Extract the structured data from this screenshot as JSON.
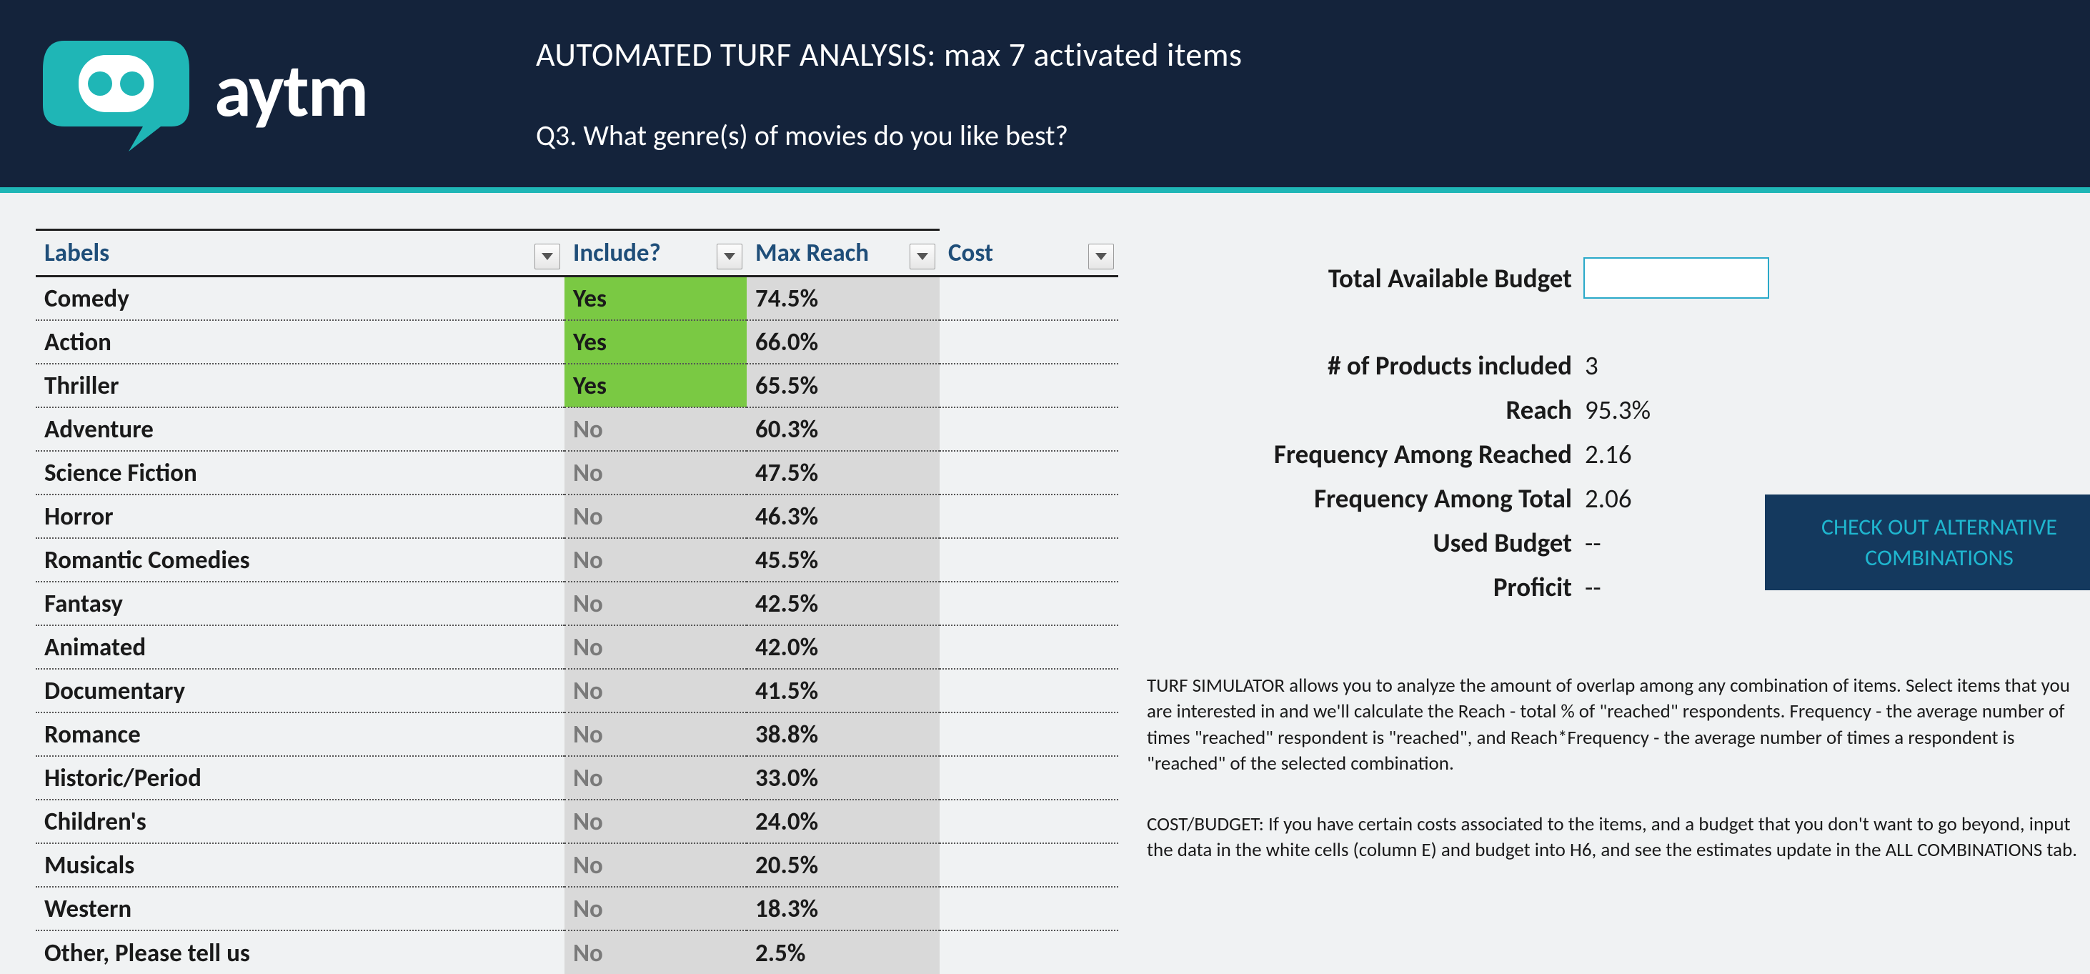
{
  "brand": {
    "name": "aytm"
  },
  "header": {
    "analysis_title": "AUTOMATED TURF ANALYSIS: max 7 activated items",
    "question_title": "Q3. What genre(s) of movies do you like best?"
  },
  "table": {
    "headers": {
      "labels": "Labels",
      "include": "Include?",
      "max_reach": "Max Reach",
      "cost": "Cost"
    },
    "rows": [
      {
        "label": "Comedy",
        "include": "Yes",
        "reach": "74.5%",
        "cost": ""
      },
      {
        "label": "Action",
        "include": "Yes",
        "reach": "66.0%",
        "cost": ""
      },
      {
        "label": "Thriller",
        "include": "Yes",
        "reach": "65.5%",
        "cost": ""
      },
      {
        "label": "Adventure",
        "include": "No",
        "reach": "60.3%",
        "cost": ""
      },
      {
        "label": "Science Fiction",
        "include": "No",
        "reach": "47.5%",
        "cost": ""
      },
      {
        "label": "Horror",
        "include": "No",
        "reach": "46.3%",
        "cost": ""
      },
      {
        "label": "Romantic Comedies",
        "include": "No",
        "reach": "45.5%",
        "cost": ""
      },
      {
        "label": "Fantasy",
        "include": "No",
        "reach": "42.5%",
        "cost": ""
      },
      {
        "label": "Animated",
        "include": "No",
        "reach": "42.0%",
        "cost": ""
      },
      {
        "label": "Documentary",
        "include": "No",
        "reach": "41.5%",
        "cost": ""
      },
      {
        "label": "Romance",
        "include": "No",
        "reach": "38.8%",
        "cost": ""
      },
      {
        "label": "Historic/Period",
        "include": "No",
        "reach": "33.0%",
        "cost": ""
      },
      {
        "label": "Children's",
        "include": "No",
        "reach": "24.0%",
        "cost": ""
      },
      {
        "label": "Musicals",
        "include": "No",
        "reach": "20.5%",
        "cost": ""
      },
      {
        "label": "Western",
        "include": "No",
        "reach": "18.3%",
        "cost": ""
      },
      {
        "label": "Other, Please tell us",
        "include": "No",
        "reach": "2.5%",
        "cost": ""
      }
    ]
  },
  "stats": {
    "total_budget_label": "Total Available Budget",
    "total_budget_value": "",
    "products_label": "# of Products included",
    "products_value": "3",
    "reach_label": "Reach",
    "reach_value": "95.3%",
    "freq_reached_label": "Frequency Among Reached",
    "freq_reached_value": "2.16",
    "freq_total_label": "Frequency Among Total",
    "freq_total_value": "2.06",
    "used_budget_label": "Used Budget",
    "used_budget_value": "--",
    "proficit_label": "Proficit",
    "proficit_value": "--"
  },
  "cta": {
    "label": "CHECK OUT ALTERNATIVE COMBINATIONS"
  },
  "descriptions": {
    "p1": "TURF SIMULATOR allows you to analyze the amount of overlap among any combination of items. Select items that you are interested in and we'll calculate the Reach - total % of \"reached\" respondents. Frequency - the average number of times \"reached\" respondent is \"reached\", and  Reach*Frequency - the average number of times a respondent is \"reached\" of the selected combination.",
    "p2": "COST/BUDGET: If you have certain costs associated to the items, and a budget that you don't want to go beyond, input the data in the white cells (column E) and budget into H6, and see the estimates update in the ALL COMBINATIONS tab."
  }
}
